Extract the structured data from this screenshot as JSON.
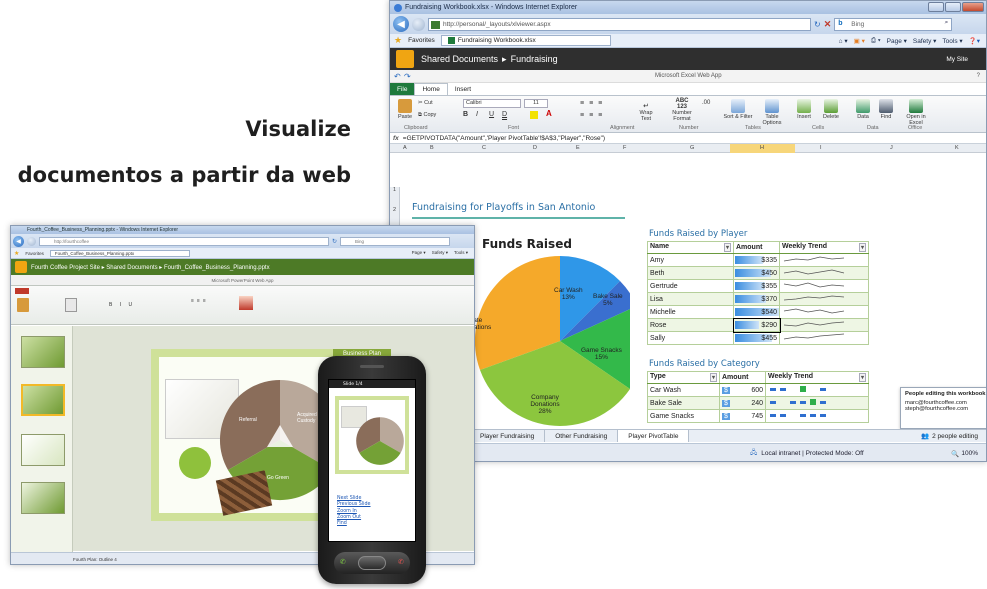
{
  "headline": {
    "line1": "Visualize",
    "line2": "documentos a partir da web"
  },
  "excel_window": {
    "title": "Fundraising Workbook.xlsx - Windows Internet Explorer",
    "address": "http://personal/_layouts/xlviewer.aspx",
    "search_placeholder": "Bing",
    "favorites_label": "Favorites",
    "tab_label": "Fundraising Workbook.xlsx",
    "command_bar": [
      "Page ▾",
      "Safety ▾",
      "Tools ▾"
    ],
    "breadcrumb_site": "Shared Documents",
    "breadcrumb_sep": "▸",
    "breadcrumb_page": "Fundraising",
    "my_site": "My Site",
    "app_name": "Microsoft Excel Web App",
    "ribbon_tabs": [
      "File",
      "Home",
      "Insert"
    ],
    "ribbon": {
      "paste": "Paste",
      "cut": "Cut",
      "copy": "Copy",
      "font_name": "Calibri",
      "font_size": "11",
      "wrap_text": "Wrap Text",
      "number_format": "Number Format",
      "sort_filter": "Sort & Filter",
      "format_table": "Table Options",
      "insert": "Insert",
      "delete": "Delete",
      "data": "Data",
      "find": "Find",
      "open_excel": "Open in Excel",
      "groups": [
        "Clipboard",
        "Font",
        "Alignment",
        "Number",
        "Tables",
        "Cells",
        "Data",
        "Office"
      ]
    },
    "formula": "=GETPIVOTDATA(\"Amount\",'Player PivotTable'!$A$3,\"Player\",\"Rose\")",
    "columns": [
      "A",
      "B",
      "C",
      "D",
      "E",
      "F",
      "G",
      "H",
      "I",
      "J",
      "K"
    ],
    "rows": [
      "1",
      "2"
    ],
    "sheet_title": "Fundraising for Playoffs in San Antonio",
    "pie_title": "Funds Raised",
    "pie_labels": [
      {
        "name": "Car Wash",
        "pct": "13%"
      },
      {
        "name": "Bake Sale",
        "pct": "5%"
      },
      {
        "name": "Game Snacks",
        "pct": "15%"
      },
      {
        "name": "Company Donations",
        "pct": "28%"
      },
      {
        "name": "Private Donations",
        "pct": "39%"
      }
    ],
    "player_table": {
      "title": "Funds Raised by Player",
      "headers": [
        "Name",
        "Amount",
        "Weekly Trend"
      ],
      "rows": [
        {
          "name": "Amy",
          "amount": "$335"
        },
        {
          "name": "Beth",
          "amount": "$450"
        },
        {
          "name": "Gertrude",
          "amount": "$355"
        },
        {
          "name": "Lisa",
          "amount": "$370"
        },
        {
          "name": "Michelle",
          "amount": "$540"
        },
        {
          "name": "Rose",
          "amount": "$290"
        },
        {
          "name": "Sally",
          "amount": "$455"
        }
      ]
    },
    "category_table": {
      "title": "Funds Raised by Category",
      "headers": [
        "Type",
        "Amount",
        "Weekly Trend"
      ],
      "rows": [
        {
          "type": "Car Wash",
          "currency": "$",
          "amount": "600"
        },
        {
          "type": "Bake Sale",
          "currency": "$",
          "amount": "240"
        },
        {
          "type": "Game Snacks",
          "currency": "$",
          "amount": "745"
        }
      ]
    },
    "sheet_tabs": [
      "Player Fundraising",
      "Other Fundraising",
      "Player PivotTable"
    ],
    "people_editing_count": "2 people editing",
    "people_popup_title": "People editing this workbook",
    "people_popup_emails": [
      "marc@fourthcoffee.com",
      "steph@fourthcoffee.com"
    ],
    "status_zone": "Local intranet | Protected Mode: Off",
    "zoom": "100%",
    "colors": {
      "title_blue": "#2a6fa5",
      "pie_car_wash": "#2f97e8",
      "pie_bake_sale": "#3a6fcf",
      "pie_game_snacks": "#33b94a",
      "pie_company": "#8cc63e",
      "pie_private": "#f5a92a"
    }
  },
  "ppt_window": {
    "title": "Fourth_Coffee_Business_Planning.pptx - Windows Internet Explorer",
    "address": "http://fourthcoffee",
    "search_placeholder": "Bing",
    "favorites_label": "Favorites",
    "tab_label": "Fourth_Coffee_Business_Planning.pptx",
    "command_bar": [
      "Page ▾",
      "Safety ▾",
      "Tools ▾"
    ],
    "breadcrumb": "Fourth Coffee Project Site ▸ Shared Documents ▸ Fourth_Coffee_Business_Planning.pptx",
    "app_name": "Microsoft PowerPoint Web App",
    "slide_title": "Business Plan",
    "segments": [
      "Referral",
      "Acquired Custody",
      "Go Green"
    ],
    "status": "Fourth Plan: Outline 4"
  },
  "phone": {
    "status_text": "Slide 1/4",
    "links": [
      "Next Slide",
      "Previous Slide",
      "Zoom In",
      "Zoom Out",
      "Find"
    ]
  }
}
